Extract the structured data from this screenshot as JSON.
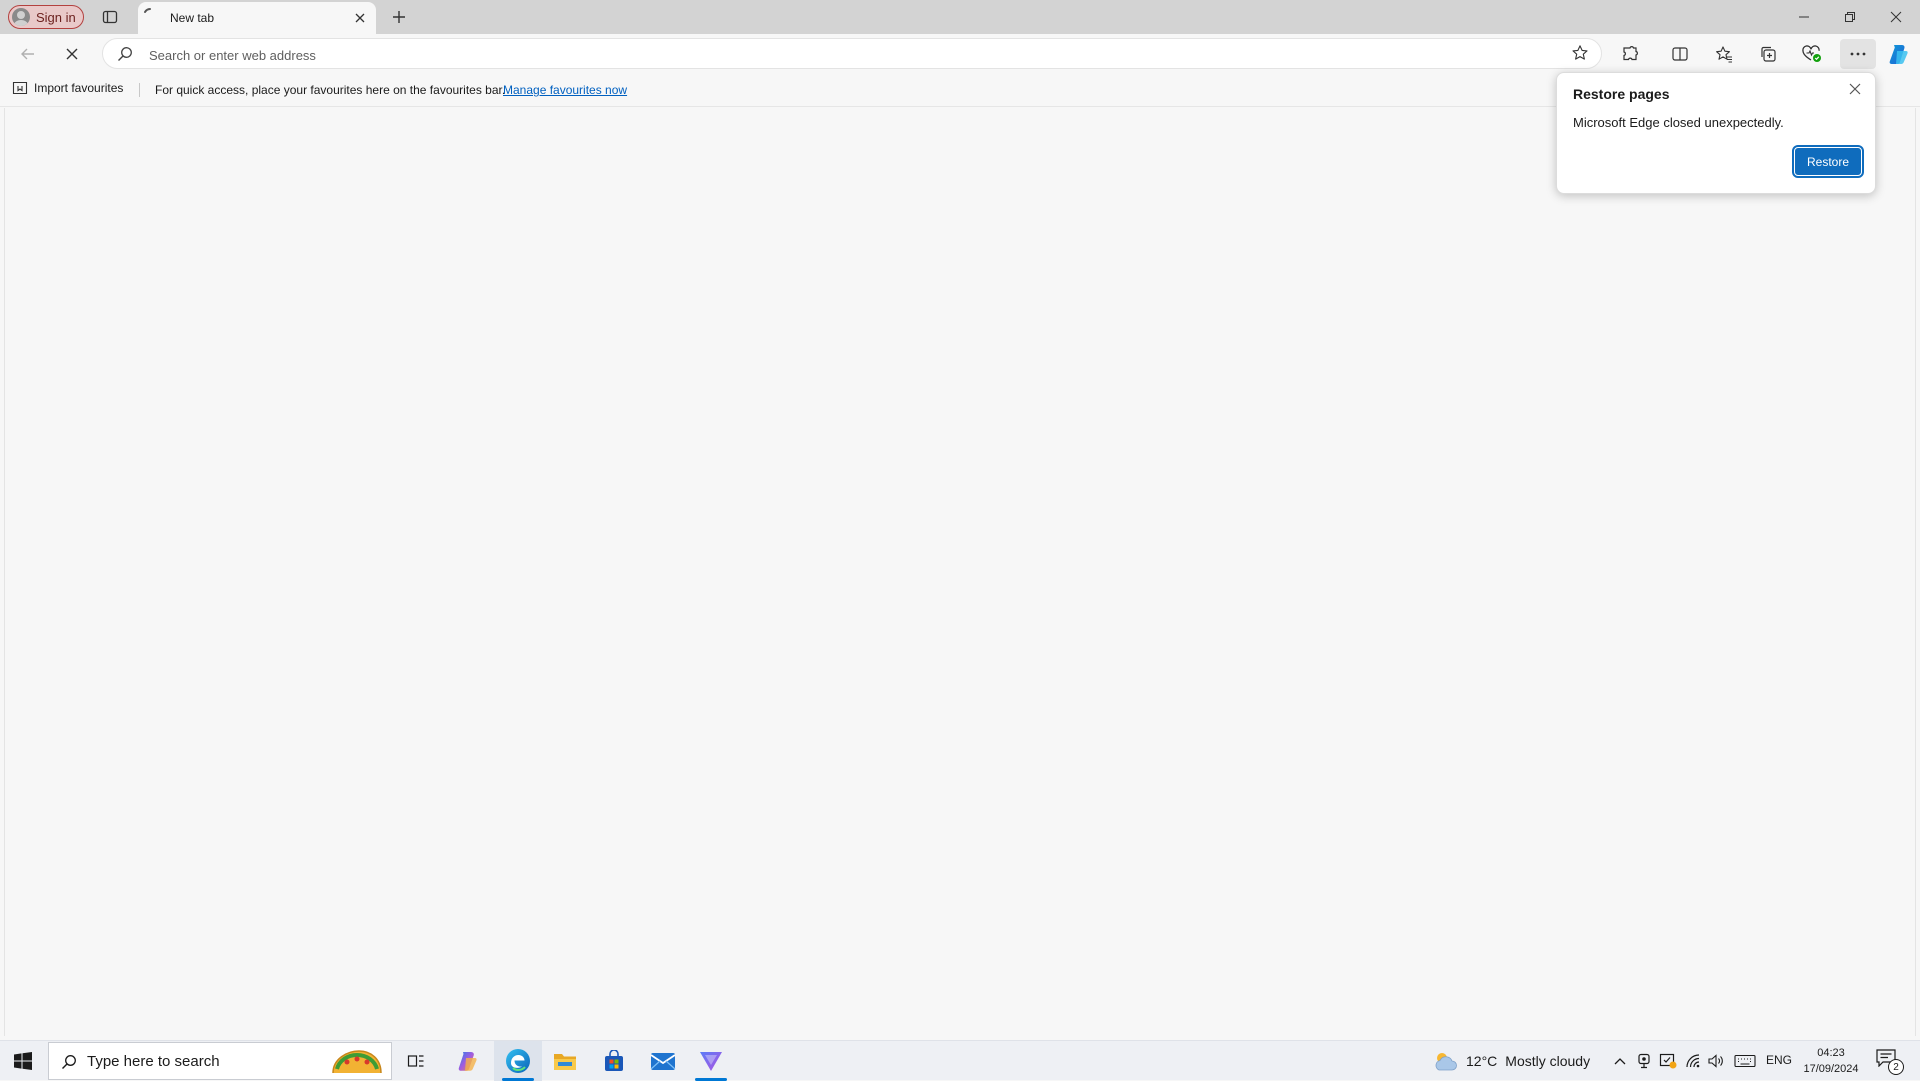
{
  "titlebar": {
    "signin_label": "Sign in",
    "tab_title": "New tab",
    "icons": [
      "profile-icon",
      "tab-actions-icon",
      "loading-spinner-icon",
      "close-icon",
      "plus-icon",
      "minimize-icon",
      "restore-window-icon",
      "close-window-icon"
    ]
  },
  "toolbar": {
    "address_placeholder": "Search or enter web address",
    "icons": [
      "back-arrow-icon",
      "stop-loading-icon",
      "search-icon",
      "add-favourite-icon",
      "extensions-icon",
      "split-screen-icon",
      "favourites-icon",
      "collections-icon",
      "browser-essentials-icon",
      "more-icon",
      "copilot-icon"
    ]
  },
  "favourites_bar": {
    "import_label": "Import favourites",
    "message": "For quick access, place your favourites here on the favourites bar.",
    "manage_link": "Manage favourites now"
  },
  "restore_popup": {
    "title": "Restore pages",
    "message": "Microsoft Edge closed unexpectedly.",
    "restore_button": "Restore"
  },
  "taskbar": {
    "search_placeholder": "Type here to search",
    "weather": {
      "temperature": "12°C",
      "condition": "Mostly cloudy"
    },
    "language": "ENG",
    "time": "04:23",
    "date": "17/09/2024",
    "notification_count": "2",
    "accent_color": "#0078d4"
  }
}
